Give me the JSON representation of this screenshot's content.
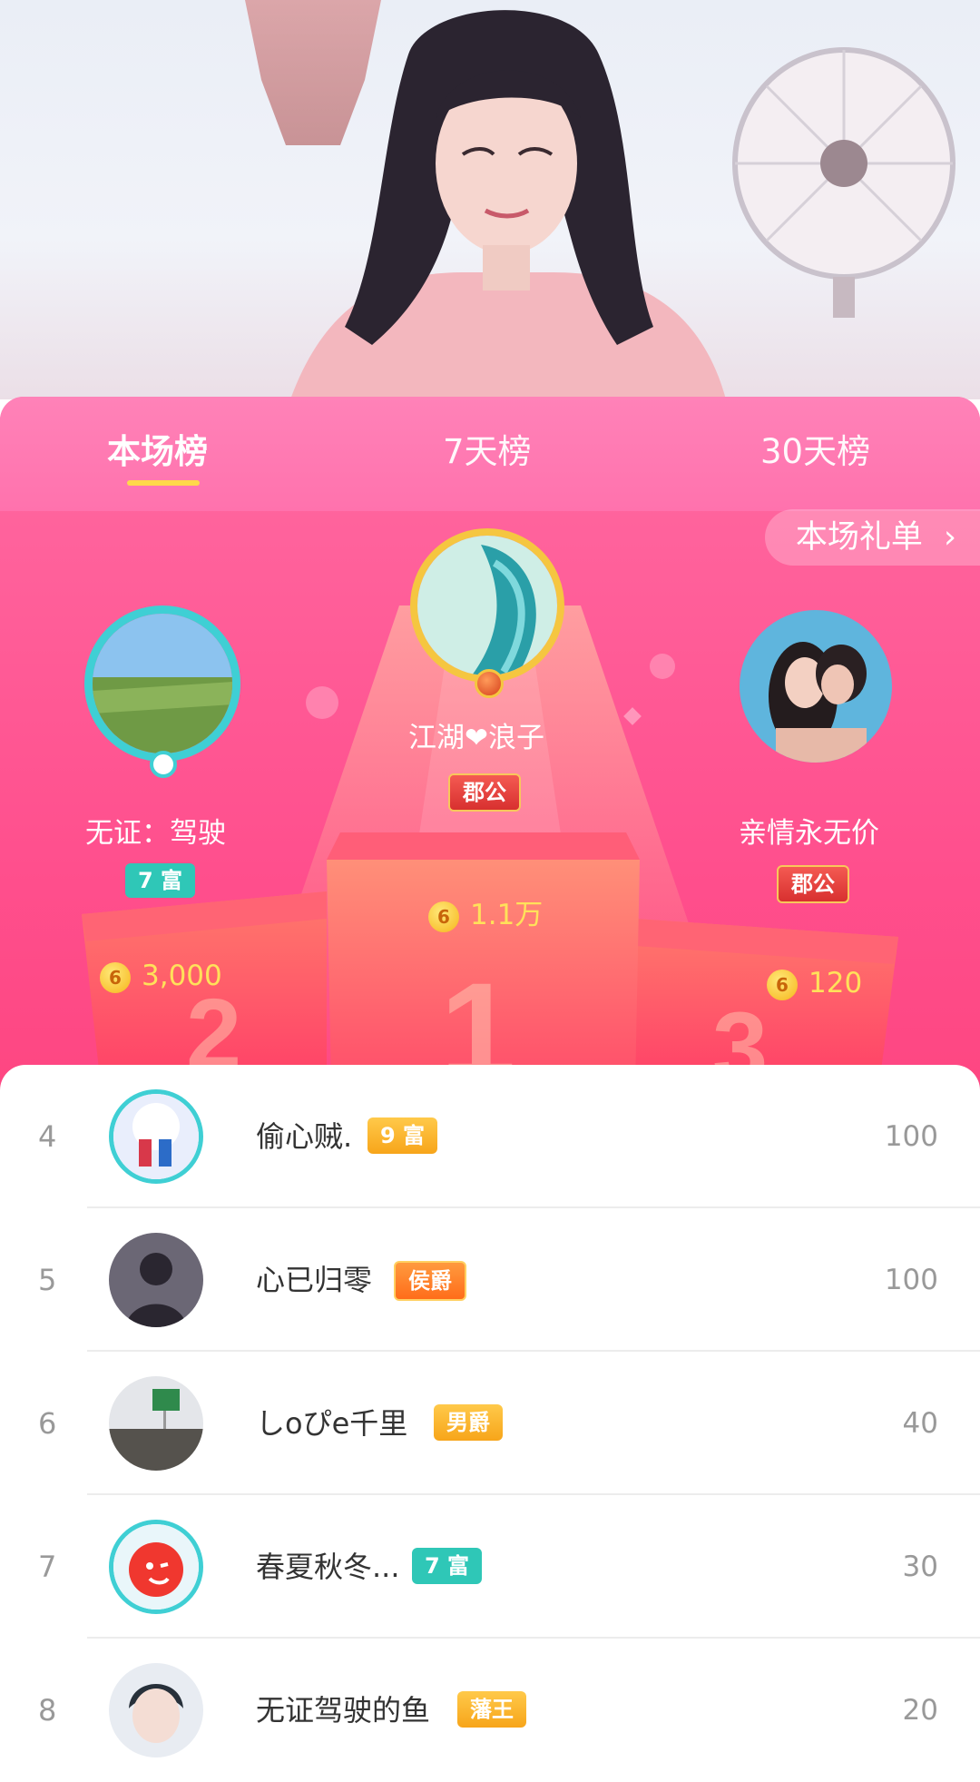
{
  "tabs": [
    {
      "label": "本场榜",
      "active": true
    },
    {
      "label": "7天榜",
      "active": false
    },
    {
      "label": "30天榜",
      "active": false
    }
  ],
  "gift_list_button": {
    "label": "本场礼单",
    "icon": "chevron-right-icon"
  },
  "podium": {
    "first": {
      "rank": "1",
      "name": "江湖❤浪子",
      "badge": "郡公",
      "coins": "1.1万"
    },
    "second": {
      "rank": "2",
      "name": "无证：驾驶",
      "badge": "7 富",
      "coins": "3,000"
    },
    "third": {
      "rank": "3",
      "name": "亲情永无价",
      "badge": "郡公",
      "coins": "120"
    }
  },
  "coin_symbol": "6",
  "list": [
    {
      "rank": "4",
      "name": "偷心贼.",
      "badge": "9 富",
      "badge_style": "gold",
      "score": "100"
    },
    {
      "rank": "5",
      "name": "心已归零",
      "badge": "侯爵",
      "badge_style": "orange",
      "score": "100"
    },
    {
      "rank": "6",
      "name": "しoぴe千里",
      "badge": "男爵",
      "badge_style": "gold",
      "score": "40"
    },
    {
      "rank": "7",
      "name": "春夏秋冬...",
      "badge": "7 富",
      "badge_style": "teal",
      "score": "30"
    },
    {
      "rank": "8",
      "name": "无证驾驶的鱼",
      "badge": "藩王",
      "badge_style": "gold",
      "score": "20"
    }
  ],
  "colors": {
    "panel": "#ff4f8d",
    "tab_underline": "#ffd84a",
    "coin_text": "#ffe15a",
    "teal_badge": "#2fc7b7"
  }
}
